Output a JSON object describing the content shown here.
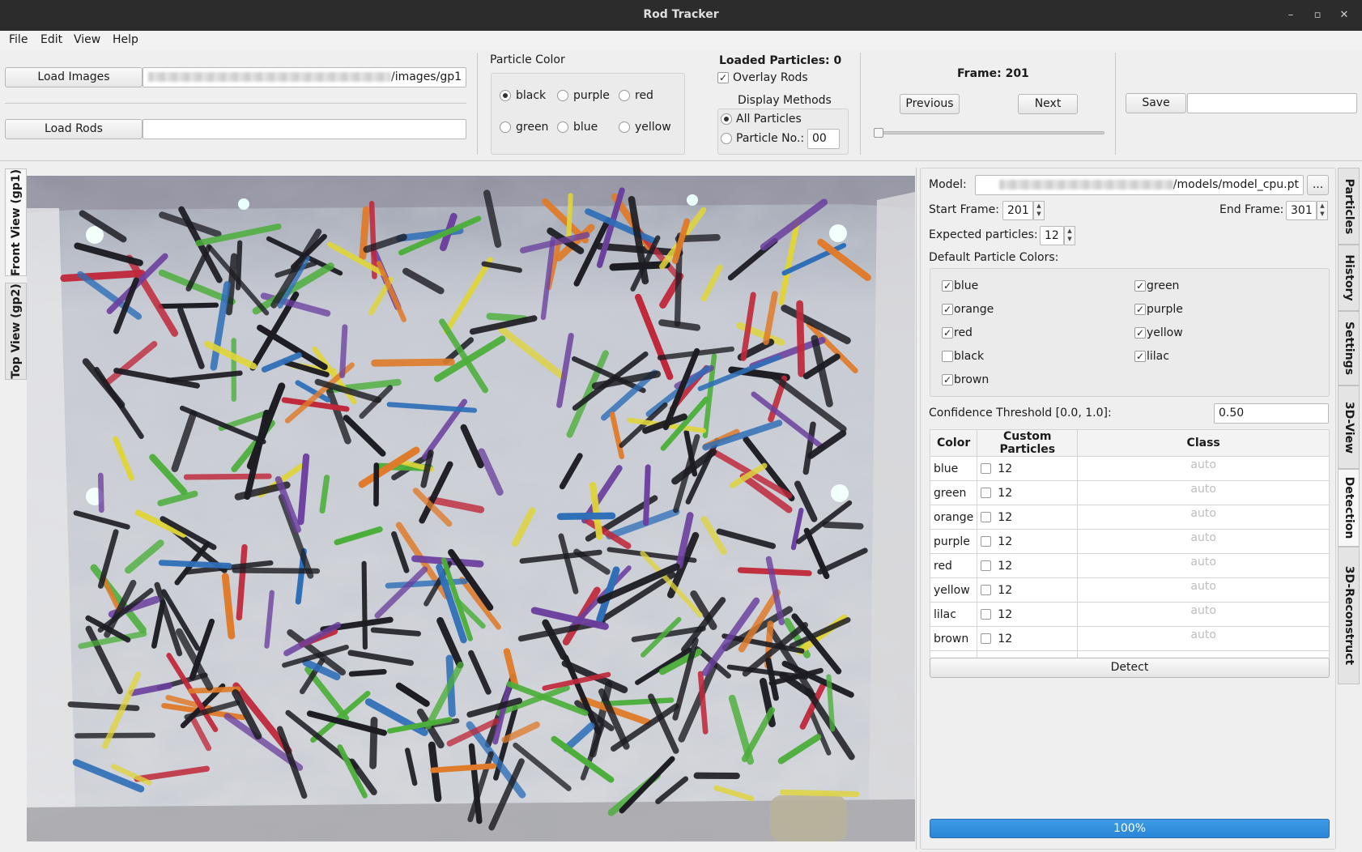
{
  "window": {
    "title": "Rod Tracker",
    "controls": [
      "–",
      "▫",
      "✕"
    ]
  },
  "menu": [
    "File",
    "Edit",
    "View",
    "Help"
  ],
  "load": {
    "images_button": "Load Images",
    "images_path": "/images/gp1",
    "rods_button": "Load Rods",
    "rods_path": ""
  },
  "particle_color": {
    "title": "Particle Color",
    "options": [
      {
        "label": "black",
        "selected": true
      },
      {
        "label": "purple",
        "selected": false
      },
      {
        "label": "red",
        "selected": false
      },
      {
        "label": "green",
        "selected": false
      },
      {
        "label": "blue",
        "selected": false
      },
      {
        "label": "yellow",
        "selected": false
      }
    ]
  },
  "display": {
    "loaded_particles": "Loaded Particles: 0",
    "overlay_rods": "Overlay Rods",
    "overlay_checked": true,
    "methods_title": "Display Methods",
    "all_particles": "All Particles",
    "particle_no": "Particle No.:",
    "particle_no_value": "00"
  },
  "frame": {
    "label": "Frame: 201",
    "previous": "Previous",
    "next": "Next",
    "slider_position": 0.0
  },
  "save": {
    "button": "Save",
    "value": ""
  },
  "left_tabs": [
    "Front View (gp1)",
    "Top View (gp2)"
  ],
  "right_tabs": [
    "Particles",
    "History",
    "Settings",
    "3D-View",
    "Detection",
    "3D-Reconstruct"
  ],
  "detection": {
    "model_label": "Model:",
    "model_path": "/models/model_cpu.pt",
    "browse_button": "...",
    "start_frame_label": "Start Frame:",
    "start_frame": "201",
    "end_frame_label": "End Frame:",
    "end_frame": "301",
    "expected_label": "Expected particles:",
    "expected": "12",
    "default_colors_label": "Default Particle Colors:",
    "default_colors": [
      {
        "label": "blue",
        "checked": true
      },
      {
        "label": "green",
        "checked": true
      },
      {
        "label": "orange",
        "checked": true
      },
      {
        "label": "purple",
        "checked": true
      },
      {
        "label": "red",
        "checked": true
      },
      {
        "label": "yellow",
        "checked": true
      },
      {
        "label": "black",
        "checked": false
      },
      {
        "label": "lilac",
        "checked": true
      },
      {
        "label": "brown",
        "checked": true
      }
    ],
    "confidence_label": "Confidence Threshold [0.0, 1.0]:",
    "confidence": "0.50",
    "table_headers": [
      "Color",
      "Custom Particles",
      "Class"
    ],
    "table_rows": [
      {
        "color": "blue",
        "count": "12",
        "class": "auto"
      },
      {
        "color": "green",
        "count": "12",
        "class": "auto"
      },
      {
        "color": "orange",
        "count": "12",
        "class": "auto"
      },
      {
        "color": "purple",
        "count": "12",
        "class": "auto"
      },
      {
        "color": "red",
        "count": "12",
        "class": "auto"
      },
      {
        "color": "yellow",
        "count": "12",
        "class": "auto"
      },
      {
        "color": "lilac",
        "count": "12",
        "class": "auto"
      },
      {
        "color": "brown",
        "count": "12",
        "class": "auto"
      }
    ],
    "detect_button": "Detect",
    "progress": "100%",
    "progress_value": 1.0
  },
  "colors": {
    "progress": "#2a86d6",
    "rod_black": "#1c1c22",
    "rod_purple": "#6b3f9e",
    "rod_red": "#c0283a",
    "rod_green": "#4caf3a",
    "rod_blue": "#2e6fb8",
    "rod_yellow": "#e0d53a",
    "rod_orange": "#e07b2a"
  }
}
